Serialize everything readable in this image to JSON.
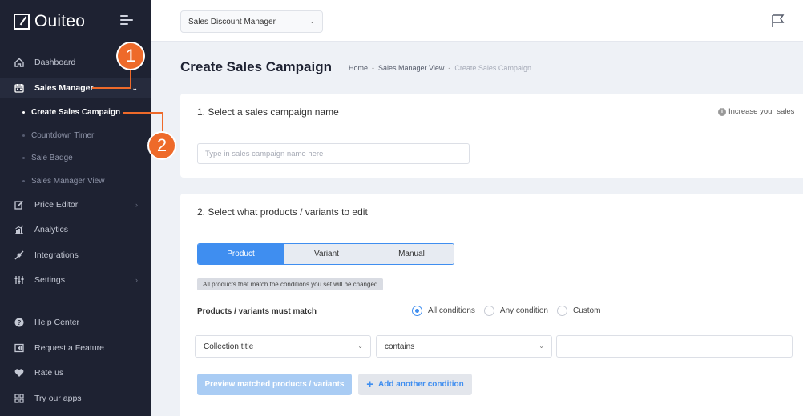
{
  "sidebar": {
    "brand": "Ouiteo",
    "items": [
      {
        "label": "Dashboard",
        "icon": "home-icon"
      },
      {
        "label": "Sales Manager",
        "icon": "calendar-icon"
      },
      {
        "label": "Price Editor",
        "icon": "edit-icon"
      },
      {
        "label": "Analytics",
        "icon": "analytics-icon"
      },
      {
        "label": "Integrations",
        "icon": "plug-icon"
      },
      {
        "label": "Settings",
        "icon": "sliders-icon"
      },
      {
        "label": "Help Center",
        "icon": "help-icon"
      },
      {
        "label": "Request a Feature",
        "icon": "request-icon"
      },
      {
        "label": "Rate us",
        "icon": "heart-icon"
      },
      {
        "label": "Try our apps",
        "icon": "apps-icon"
      }
    ],
    "sub_items": [
      {
        "label": "Create Sales Campaign"
      },
      {
        "label": "Countdown Timer"
      },
      {
        "label": "Sale Badge"
      },
      {
        "label": "Sales Manager View"
      }
    ]
  },
  "callouts": [
    "1",
    "2"
  ],
  "topbar": {
    "app_select": "Sales Discount Manager"
  },
  "page": {
    "title": "Create Sales Campaign",
    "breadcrumb": [
      "Home",
      "Sales Manager View",
      "Create Sales Campaign"
    ],
    "breadcrumb_sep": "-"
  },
  "step1": {
    "heading": "1. Select a sales campaign name",
    "hint": "Increase your sales",
    "input_placeholder": "Type in sales campaign name here",
    "input_value": ""
  },
  "step2": {
    "heading": "2. Select what products / variants to edit",
    "tabs": [
      "Product",
      "Variant",
      "Manual"
    ],
    "note": "All products that match the conditions you set will be changed",
    "match_label": "Products / variants must match",
    "radios": [
      "All conditions",
      "Any condition",
      "Custom"
    ],
    "condition_field": "Collection title",
    "condition_operator": "contains",
    "condition_value": "",
    "preview_button": "Preview matched products / variants",
    "add_button": "Add another condition"
  },
  "colors": {
    "sidebar_bg": "#1e2232",
    "accent": "#3f8ef0",
    "callout": "#ee6a2a"
  }
}
